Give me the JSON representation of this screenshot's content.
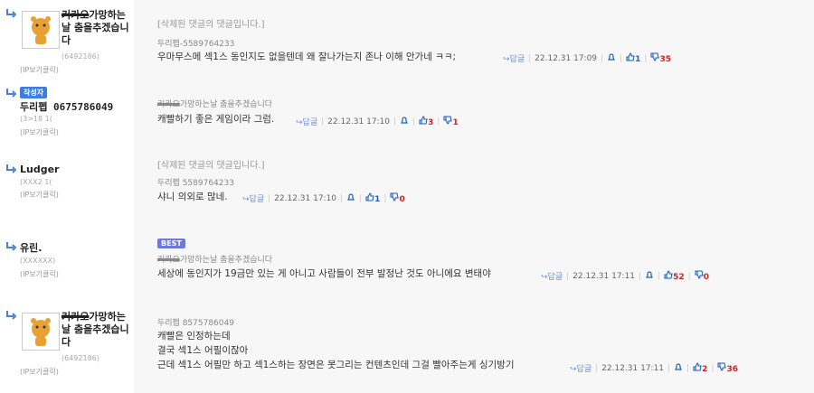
{
  "comments": [
    {
      "nickname_prefix": "커카오",
      "nickname": "가망하는 날 춤을추겠습니다",
      "user_id": "(6492186)",
      "ip_label": "(IP보기클릭)",
      "deleted_notice": "[삭제된 댓글의 댓글입니다.]",
      "reply_to": "두리펩-5589764233",
      "text": "우마무스메 섹1스 동인지도 없을텐데 왜 잘나가는지 존나 이해 안가네 ㅋㅋ;",
      "reply_label": "답글",
      "date": "22.12.31 17:09",
      "up": "1",
      "down": "35"
    },
    {
      "badge": "작성자",
      "nickname": "두리펩 0675786049",
      "user_id": "(3>18 1(",
      "ip_label": "(IP보기클릭)",
      "reply_to_prefix": "커카오",
      "reply_to": "가망하는날 춤을추겠습니다",
      "text": "캐빨하기 좋은 게임이라 그럼.",
      "reply_label": "답글",
      "date": "22.12.31 17:10",
      "up": "3",
      "down": "1"
    },
    {
      "nickname": "Ludger",
      "user_id": "(XXX2 1(",
      "ip_label": "(IP보기클릭)",
      "deleted_notice": "[삭제된 댓글의 댓글입니다.]",
      "reply_to": "두리펩 5589764233",
      "text": "샤니 의외로 많네.",
      "reply_label": "답글",
      "date": "22.12.31 17:10",
      "up": "1",
      "down": "0"
    },
    {
      "nickname": "유린.",
      "user_id": "(XXXXXX)",
      "ip_label": "(IP보기클릭)",
      "badge": "BEST",
      "reply_to_prefix": "커카오",
      "reply_to": "가망하는날 춤을추겠습니다",
      "text": "세상에 동인지가 19금만 있는 게 아니고 사람들이 전부 발정난 것도 아니에요 변태야",
      "reply_label": "답글",
      "date": "22.12.31 17:11",
      "up": "52",
      "down": "0"
    },
    {
      "nickname_prefix": "커카오",
      "nickname": "가망하는 날 춤을추겠습니다",
      "user_id": "(6492186)",
      "ip_label": "(IP보기클릭)",
      "reply_to": "두리펩 8575786049",
      "text_lines": [
        "캐빨은 인정하는데",
        "결국 섹1스 어필이잖아",
        "근데 섹1스 어필만 하고 섹1스하는 장면은 못그리는 컨텐츠인데 그걸 빨아주는게 싱기방기"
      ],
      "reply_label": "답글",
      "date": "22.12.31 17:11",
      "up": "2",
      "down": "36"
    }
  ],
  "colors": {
    "author_badge": "#3d7de0",
    "best_badge": "#6c79d9",
    "upvote": "#1a5fc1",
    "downvote": "#d91e1e"
  }
}
